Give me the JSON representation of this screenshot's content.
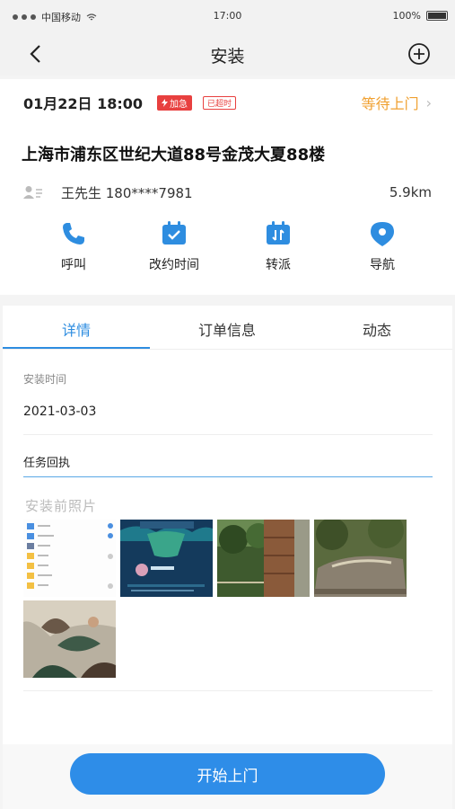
{
  "statusbar": {
    "carrier": "中国移动",
    "time": "17:00",
    "battery": "100%"
  },
  "navbar": {
    "title": "安装"
  },
  "order": {
    "datetime": "01月22日 18:00",
    "urgent_badge": "加急",
    "timeout_badge": "已超时",
    "status": "等待上门",
    "address": "上海市浦东区世纪大道88号金茂大夏88楼",
    "contact": "王先生  180****7981",
    "distance": "5.9km"
  },
  "actions": [
    {
      "label": "呼叫",
      "icon": "phone-icon"
    },
    {
      "label": "改约时间",
      "icon": "calendar-icon"
    },
    {
      "label": "转派",
      "icon": "transfer-icon"
    },
    {
      "label": "导航",
      "icon": "location-pin-icon"
    }
  ],
  "tabs": [
    {
      "label": "详情",
      "active": true
    },
    {
      "label": "订单信息",
      "active": false
    },
    {
      "label": "动态",
      "active": false
    }
  ],
  "detail": {
    "install_time_label": "安装时间",
    "install_time_value": "2021-03-03",
    "receipt_label": "任务回执",
    "photos_label": "安装前照片"
  },
  "photos": [
    {
      "name": "photo-1",
      "desc": "phone screenshot with folder list"
    },
    {
      "name": "photo-2",
      "desc": "live stream graphic"
    },
    {
      "name": "photo-3",
      "desc": "forest and fence"
    },
    {
      "name": "photo-4",
      "desc": "brick pillar"
    },
    {
      "name": "photo-5",
      "desc": "engraved rock in forest"
    },
    {
      "name": "photo-6",
      "desc": "lotus flower art"
    }
  ],
  "bottom": {
    "start_button": "开始上门"
  },
  "colors": {
    "accent": "#2e8de0",
    "status": "#f0a030",
    "urgent": "#e8403f"
  }
}
